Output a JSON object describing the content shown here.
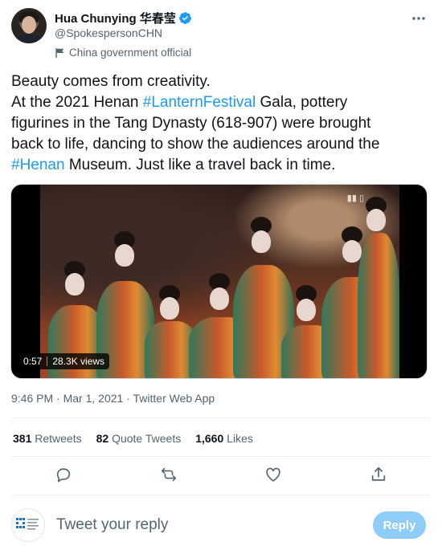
{
  "author": {
    "display_name": "Hua Chunying 华春莹",
    "handle": "@SpokespersonCHN",
    "affiliation": "China government official"
  },
  "tweet": {
    "line1": "Beauty comes from creativity.",
    "line2_a": "At the 2021 Henan ",
    "line2_tag": "#LanternFestival",
    "line2_b": " Gala, pottery",
    "line3": "figurines in the Tang Dynasty (618-907) were brought",
    "line4": "back to life, dancing to show the audiences around the",
    "line5_tag": "#Henan",
    "line5_b": " Museum. Just like a travel back in time."
  },
  "media": {
    "duration": "0:57",
    "views": "28.3K views"
  },
  "meta": {
    "time": "9:46 PM",
    "date": "Mar 1, 2021",
    "source": "Twitter Web App",
    "sep": " · "
  },
  "stats": {
    "retweets_count": "381",
    "retweets_label": "Retweets",
    "quotes_count": "82",
    "quotes_label": "Quote Tweets",
    "likes_count": "1,660",
    "likes_label": "Likes"
  },
  "actions": {
    "icons": [
      "reply-icon",
      "retweet-icon",
      "like-icon",
      "share-icon"
    ]
  },
  "reply": {
    "placeholder": "Tweet your reply",
    "button_label": "Reply"
  },
  "colors": {
    "accent": "#1d9bf0",
    "reply_button_disabled": "#8ecdf8",
    "muted_text": "#536471"
  }
}
